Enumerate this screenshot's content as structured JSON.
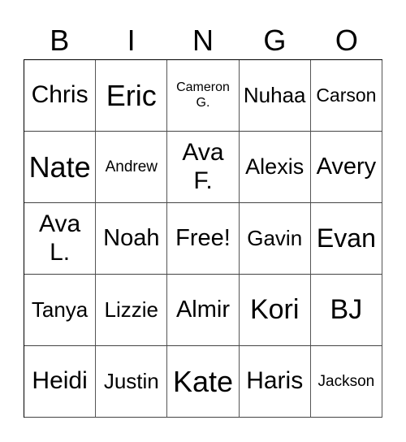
{
  "header": {
    "letters": [
      "B",
      "I",
      "N",
      "G",
      "O"
    ]
  },
  "card": {
    "cells": [
      "Chris",
      "Eric",
      "Cameron G.",
      "Nuhaa",
      "Carson",
      "Nate",
      "Andrew",
      "Ava F.",
      "Alexis",
      "Avery",
      "Ava L.",
      "Noah",
      "Free!",
      "Gavin",
      "Evan",
      "Tanya",
      "Lizzie",
      "Almir",
      "Kori",
      "BJ",
      "Heidi",
      "Justin",
      "Kate",
      "Haris",
      "Jackson"
    ]
  }
}
